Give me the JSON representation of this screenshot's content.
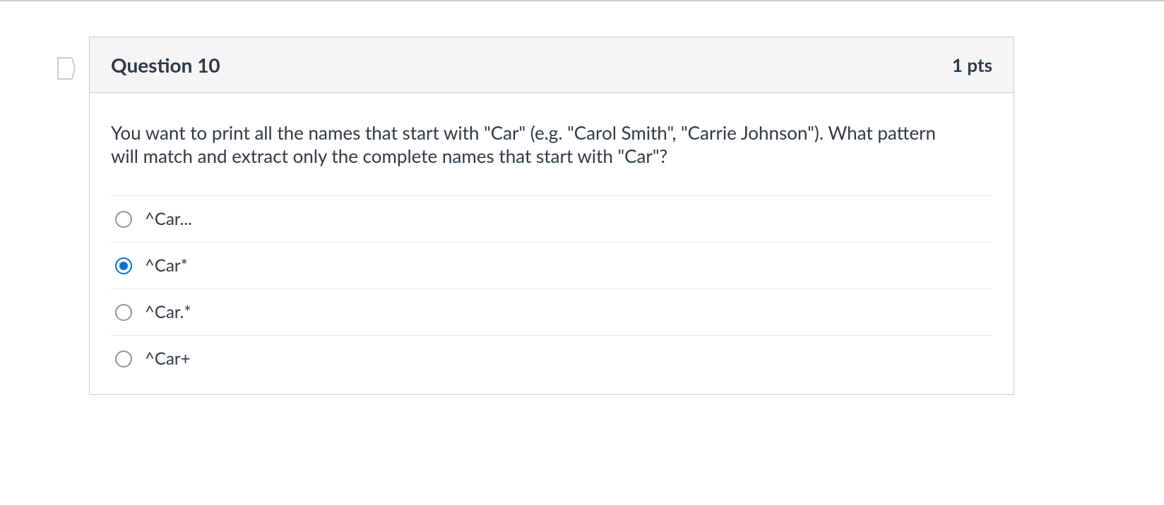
{
  "question": {
    "title": "Question 10",
    "points": "1 pts",
    "prompt": "You want to print all the names that start with \"Car\" (e.g. \"Carol Smith\", \"Carrie Johnson\"). What pattern will match and extract only the complete names that start with \"Car\"?",
    "options": [
      {
        "label": "^Car...",
        "selected": false
      },
      {
        "label": "^Car*",
        "selected": true
      },
      {
        "label": "^Car.*",
        "selected": false
      },
      {
        "label": "^Car+",
        "selected": false
      }
    ]
  }
}
